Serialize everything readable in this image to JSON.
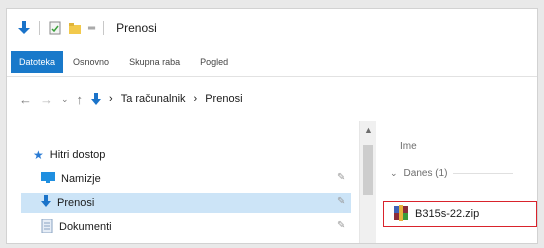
{
  "window": {
    "title": "Prenosi"
  },
  "ribbon": {
    "tabs": [
      "Datoteka",
      "Osnovno",
      "Skupna raba",
      "Pogled"
    ]
  },
  "address": {
    "crumbs": [
      "Ta računalnik",
      "Prenosi"
    ]
  },
  "navigation": {
    "quick_access": "Hitri dostop",
    "items": [
      {
        "label": "Namizje",
        "icon": "desktop-icon"
      },
      {
        "label": "Prenosi",
        "icon": "downloads-icon"
      },
      {
        "label": "Dokumenti",
        "icon": "documents-icon"
      }
    ]
  },
  "content": {
    "column_name": "Ime",
    "group": "Danes (1)",
    "file": "B315s-22.zip"
  },
  "colors": {
    "accent": "#1979ca",
    "selection": "#cce4f7",
    "highlight_box": "#d9232c"
  }
}
